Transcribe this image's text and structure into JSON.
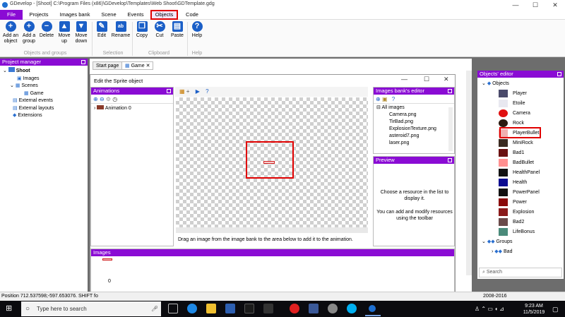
{
  "title": "GDevelop - [Shoot] C:\\Program Files (x86)\\GDevelop\\Templates\\Web Shoot\\GDTemplate.gdg",
  "window_controls": [
    "—",
    "☐",
    "✕"
  ],
  "menu": [
    "File",
    "Projects",
    "Images bank",
    "Scene",
    "Events",
    "Objects",
    "Code"
  ],
  "ribbon": {
    "buttons": [
      {
        "label": "Add an object",
        "icon": "plus-icon",
        "color": "#1b5fc7"
      },
      {
        "label": "Add a group",
        "icon": "plus-icon",
        "color": "#1b5fc7"
      },
      {
        "label": "Delete",
        "icon": "minus-icon",
        "color": "#1b5fc7"
      },
      {
        "label": "Move up",
        "icon": "arrow-up-icon",
        "color": "#1b5fc7"
      },
      {
        "label": "Move down",
        "icon": "arrow-down-icon",
        "color": "#1b5fc7"
      },
      {
        "label": "Edit",
        "icon": "edit-icon",
        "color": "#1b5fc7"
      },
      {
        "label": "Rename",
        "icon": "rename-icon",
        "color": "#1b5fc7"
      },
      {
        "label": "Copy",
        "icon": "copy-icon",
        "color": "#1b5fc7"
      },
      {
        "label": "Cut",
        "icon": "scissors-icon",
        "color": "#1b5fc7"
      },
      {
        "label": "Paste",
        "icon": "paste-icon",
        "color": "#1b5fc7"
      },
      {
        "label": "Help",
        "icon": "help-icon",
        "color": "#1b5fc7"
      }
    ],
    "groups": [
      "Objects and groups",
      "Selection",
      "Clipboard",
      "Help"
    ]
  },
  "project_manager": {
    "title": "Project manager",
    "items": [
      "Shoot",
      "Images",
      "Scenes",
      "Game",
      "External events",
      "External layouts",
      "Extensions"
    ]
  },
  "tabs": [
    "Start page",
    "Game"
  ],
  "dialog": {
    "title": "Edit the Sprite object",
    "animations_title": "Animations",
    "animation_item": "Animation 0",
    "hint": "Drag an image from the image bank to the area below to add it to the animation.",
    "images_title": "Images",
    "image_index": "0"
  },
  "images_bank_editor": {
    "title": "Images bank's editor",
    "root": "All images",
    "items": [
      "Camera.png",
      "TirBad.png",
      "ExplosionTexture.png",
      "asteroid7.png",
      "laser.png"
    ]
  },
  "preview": {
    "title": "Preview",
    "line1": "Choose a resource in the list to display it.",
    "line2": "You can add and modify resources using the toolbar"
  },
  "objects_editor": {
    "title": "Objects' editor",
    "root": "Objects",
    "items": [
      {
        "name": "Player",
        "color": "#4a4a6a"
      },
      {
        "name": "Etoile",
        "color": "#e8e8f0"
      },
      {
        "name": "Camera",
        "color": "#e01010"
      },
      {
        "name": "Rock",
        "color": "#2a1a10"
      },
      {
        "name": "PlayerBullet",
        "color": "#f0b0b0"
      },
      {
        "name": "MiniRock",
        "color": "#3a2a20"
      },
      {
        "name": "Bad1",
        "color": "#6a1010"
      },
      {
        "name": "BadBullet",
        "color": "#ff9090"
      },
      {
        "name": "HealthPanel",
        "color": "#111111"
      },
      {
        "name": "Health",
        "color": "#0a0a90"
      },
      {
        "name": "PowerPanel",
        "color": "#111111"
      },
      {
        "name": "Power",
        "color": "#8a0a0a"
      },
      {
        "name": "Explosion",
        "color": "#8a1a1a"
      },
      {
        "name": "Bad2",
        "color": "#6a4a4a"
      },
      {
        "name": "LifeBonus",
        "color": "#4a8a7a"
      }
    ],
    "groups_label": "Groups",
    "group_items": [
      "Bad"
    ],
    "search_placeholder": "Search"
  },
  "status": {
    "position": "Position 712.537598;-597.653076. SHIFT fo",
    "years": "2008-2016"
  },
  "taskbar": {
    "search_placeholder": "Type here to search",
    "time": "9:23 AM",
    "date": "11/5/2019"
  }
}
